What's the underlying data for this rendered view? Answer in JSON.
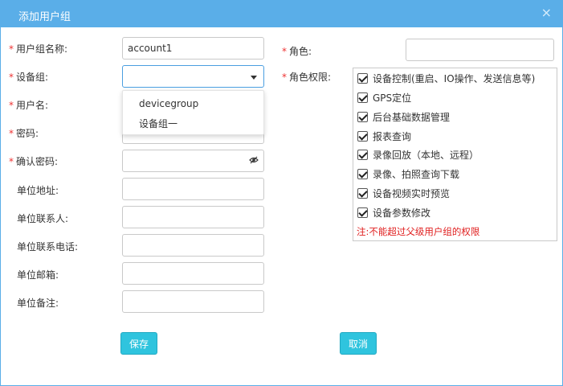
{
  "dialog": {
    "title": "添加用户组",
    "close_icon": "×"
  },
  "form": {
    "required_mark": "*",
    "group_name": {
      "label": "用户组名称:",
      "value": "account1"
    },
    "device_group": {
      "label": "设备组:",
      "value": ""
    },
    "username": {
      "label": "用户名:",
      "value": ""
    },
    "password": {
      "label": "密码:",
      "value": ""
    },
    "confirm_password": {
      "label": "确认密码:",
      "value": ""
    },
    "unit_address": {
      "label": "单位地址:",
      "value": ""
    },
    "unit_contact": {
      "label": "单位联系人:",
      "value": ""
    },
    "unit_phone": {
      "label": "单位联系电话:",
      "value": ""
    },
    "unit_email": {
      "label": "单位邮箱:",
      "value": ""
    },
    "unit_remark": {
      "label": "单位备注:",
      "value": ""
    },
    "role": {
      "label": "角色:",
      "value": ""
    },
    "role_permissions": {
      "label": "角色权限:"
    }
  },
  "dropdown": {
    "options": [
      "devicegroup",
      "设备组一"
    ]
  },
  "permissions": [
    {
      "label": "设备控制(重启、IO操作、发送信息等)",
      "checked": true
    },
    {
      "label": "GPS定位",
      "checked": true
    },
    {
      "label": "后台基础数据管理",
      "checked": true
    },
    {
      "label": "报表查询",
      "checked": true
    },
    {
      "label": "录像回放（本地、远程）",
      "checked": true
    },
    {
      "label": "录像、拍照查询下载",
      "checked": true
    },
    {
      "label": "设备视频实时预览",
      "checked": true
    },
    {
      "label": "设备参数修改",
      "checked": true
    }
  ],
  "permission_note": "注:不能超过父级用户组的权限",
  "buttons": {
    "save": "保存",
    "cancel": "取消"
  },
  "colors": {
    "titlebar": "#5aaee8",
    "button": "#2fc4de",
    "required": "#e33333",
    "note": "#e02020"
  }
}
